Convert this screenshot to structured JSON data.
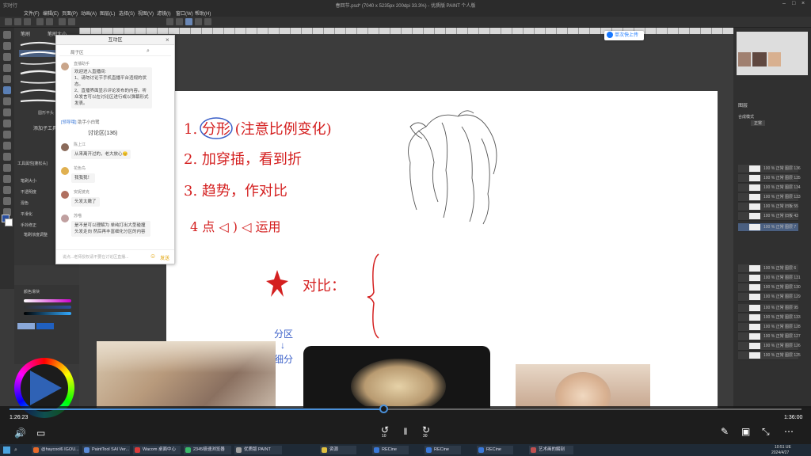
{
  "window": {
    "title": "春回节.psd* (7040 x 5235px 200dpi 33.3%) - 优质版 PAINT 个人版",
    "corner_label": "实时行"
  },
  "menu": {
    "items": [
      "文件(F)",
      "编辑(E)",
      "页面(P)",
      "动画(A)",
      "图层(L)",
      "选择(S)",
      "视图(V)",
      "滤镜(I)",
      "窗口(W)",
      "帮助(H)"
    ]
  },
  "sidebar": {
    "tabs": [
      "笔刷",
      "笔刷大小"
    ],
    "add_tool": "添加子工具",
    "brush_name": "圆形平头",
    "tool_props_title": "工具属性[蓬松头]",
    "prop_labels": [
      "笔刷大小",
      "不透明度",
      "混色",
      "平滑化",
      "手抖修正"
    ],
    "extra_label": "笔刷浓度调整"
  },
  "color": {
    "title": "颜色滑块"
  },
  "right_panel": {
    "title": "图层",
    "blend_label": "合成模式",
    "blend_value": "正常",
    "layer_names": [
      "100 % 正常 图层 136",
      "100 % 正常 图层 135",
      "100 % 正常 图层 134",
      "100 % 正常 图层 133",
      "100 % 正常 旧板 55",
      "100 % 正常 旧板 43",
      "100 % 正常 图层 7",
      "100 % 正常 图层 6",
      "100 % 正常 图层 131",
      "100 % 正常 图层 130",
      "100 % 正常 图层 129",
      "100 % 正常 图层 95",
      "100 % 正常 图层 133",
      "100 % 正常 图层 128",
      "100 % 正常 图层 127",
      "100 % 正常 图层 126",
      "100 % 正常 图层 125"
    ]
  },
  "chat": {
    "header": "互动区",
    "search_placeholder": "局子区",
    "host_name": "直播助手",
    "welcome_lines": [
      "欢迎进入直播间:",
      "1、请勿讨论节手机直播平台违规的状态。",
      "2、直播界面显示评论发布的内容。听众发言可以在讨论区进行或以弹幕形式发表。"
    ],
    "notice_tag": "[领导哦]",
    "notice_text": "助手小白鹭",
    "discussion_label": "讨论区(136)",
    "messages": [
      {
        "nick": "陈上江",
        "text": "从来离开过的，老大放心😊"
      },
      {
        "nick": "花色鸟",
        "text": "我我我！"
      },
      {
        "nick": "安妮婆克",
        "text": "头发太嫩了"
      },
      {
        "nick": "苏喵",
        "text": "是不是可以理解为 单纯打出大型碰撞头发走向 然后再丰富细化分区的内容"
      }
    ],
    "input_placeholder": "说点...老师授权请不要在讨论区直播...",
    "send_label": "发送"
  },
  "upload_button": "单次快上传",
  "canvas_notes": {
    "line1": "1. 分形 (注意比例变化)",
    "line2": "2. 加穿插，看到折",
    "line3": "3. 趋势，作对比",
    "line4": "4 点 ◁ ) ◁ 运用",
    "contrast": "对比：",
    "side1": "分区",
    "side2": "细分"
  },
  "player": {
    "current_time": "1:26:23",
    "total_time": "1:36:00",
    "progress": 0.472,
    "skip_back": "10",
    "skip_fwd": "30"
  },
  "taskbar": {
    "items": [
      "@haycool6 IGOU...",
      "PaintTool SAI Ver...",
      "Wacom 桌面中心",
      "2345极速浏览器",
      "优质版 PAINT",
      "资源",
      "RECine",
      "RECine",
      "RECine",
      "艺术画的解剖"
    ],
    "clock": "10:51 UE",
    "date": "2024/4/27"
  },
  "colors": {
    "accent": "#4a90d9",
    "ink": "#d42020"
  }
}
